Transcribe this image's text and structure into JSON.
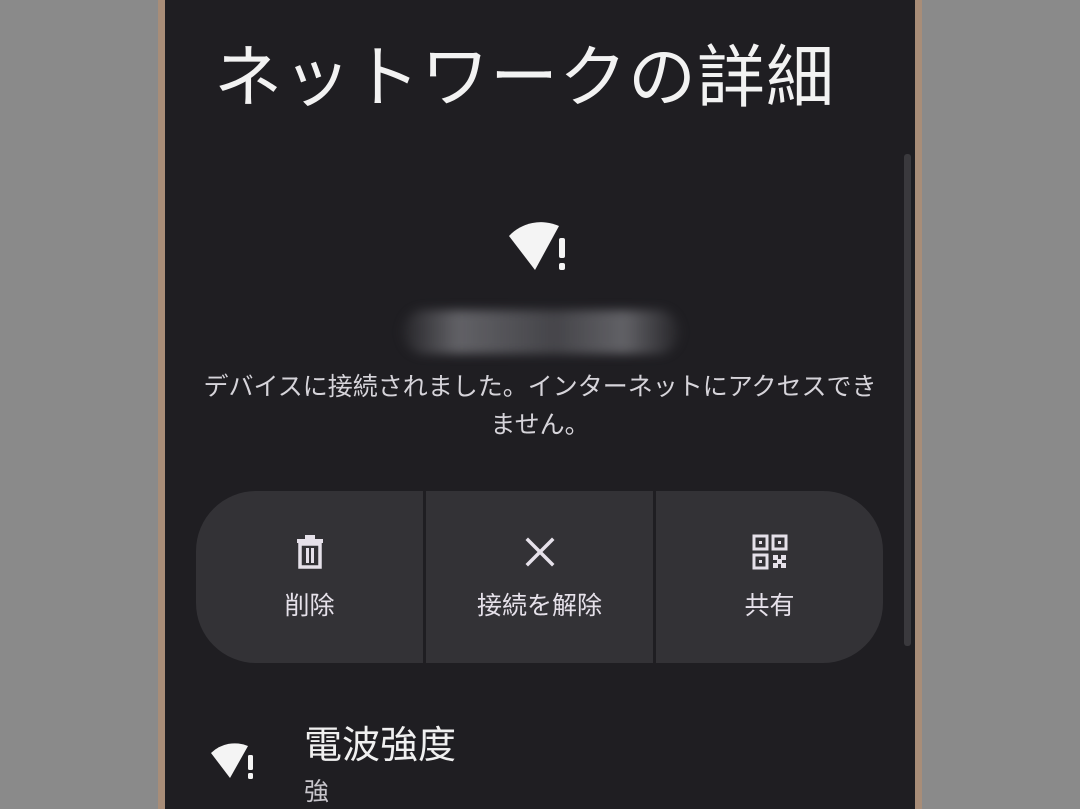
{
  "page": {
    "title": "ネットワークの詳細"
  },
  "network": {
    "icon": "wifi-warning-icon",
    "status_text": "デバイスに接続されました。インターネットにアクセスできません。"
  },
  "actions": [
    {
      "label": "削除",
      "icon": "trash-icon"
    },
    {
      "label": "接続を解除",
      "icon": "close-icon"
    },
    {
      "label": "共有",
      "icon": "qr-code-icon"
    }
  ],
  "signal": {
    "title": "電波強度",
    "value": "強",
    "icon": "wifi-warning-icon"
  },
  "colors": {
    "background": "#1f1e22",
    "button": "#333236",
    "text": "#f2f2f2",
    "frame": "#a88d78"
  }
}
